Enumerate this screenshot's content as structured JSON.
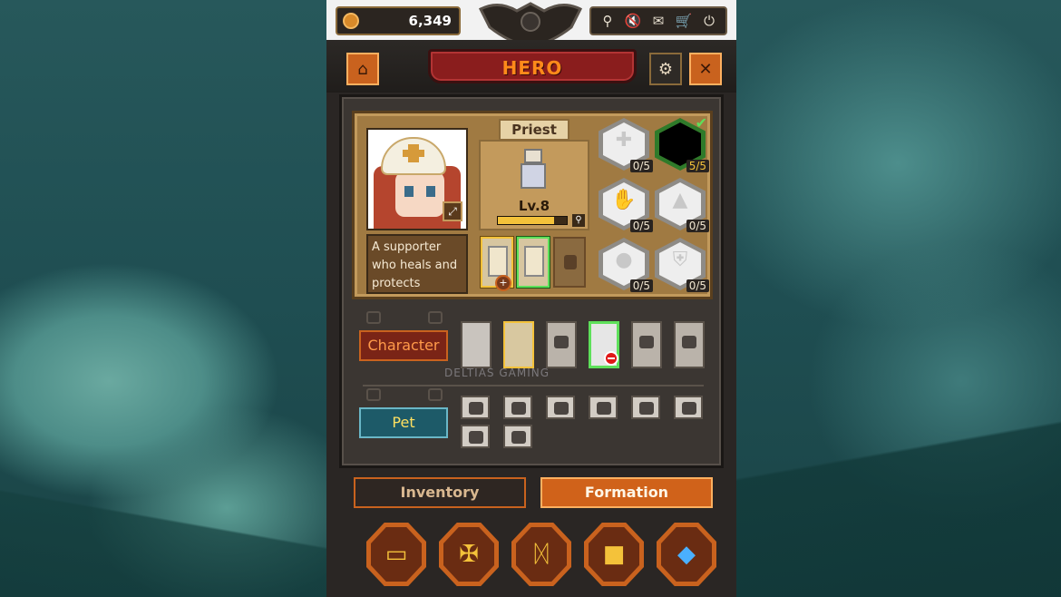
{
  "currency": {
    "value": "6,349",
    "icon": "coin-icon"
  },
  "system_icons": [
    "pin-icon",
    "sound-muted-icon",
    "mail-icon",
    "shop-cart-icon",
    "power-icon"
  ],
  "header": {
    "title": "HERO",
    "back_icon": "exit-door-icon",
    "settings_icon": "gear-icon",
    "close_icon": "close-icon"
  },
  "hero": {
    "class_name": "Priest",
    "level_label": "Lv.8",
    "xp_fraction": 0.82,
    "description": "A supporter who heals and protects",
    "skin_slots": [
      {
        "state": "owned"
      },
      {
        "state": "selected"
      },
      {
        "state": "locked"
      }
    ],
    "equipment": [
      {
        "icon": "cross-shield-icon",
        "count": "0/5",
        "equipped": false
      },
      {
        "icon": "dark-gem-icon",
        "count": "5/5",
        "equipped": true
      },
      {
        "icon": "hand-icon",
        "count": "0/5",
        "equipped": false
      },
      {
        "icon": "flame-icon",
        "count": "0/5",
        "equipped": false
      },
      {
        "icon": "bomb-icon",
        "count": "0/5",
        "equipped": false
      },
      {
        "icon": "armor-icon",
        "count": "0/5",
        "equipped": false
      }
    ]
  },
  "roster": {
    "character_label": "Character",
    "pet_label": "Pet",
    "characters": [
      {
        "name": "knight",
        "state": "owned"
      },
      {
        "name": "hero-blonde",
        "state": "selected"
      },
      {
        "name": "locked-1",
        "state": "locked"
      },
      {
        "name": "priest",
        "state": "in-formation"
      },
      {
        "name": "locked-2",
        "state": "locked"
      },
      {
        "name": "locked-3",
        "state": "locked"
      }
    ],
    "pet_slot_count": 8,
    "watermark": "DELTIAS GAMING"
  },
  "tabs": [
    {
      "label": "Inventory",
      "active": false
    },
    {
      "label": "Formation",
      "active": true
    }
  ],
  "bottom_nav": [
    {
      "icon": "chest-icon"
    },
    {
      "icon": "cross-icon"
    },
    {
      "icon": "rune-icon"
    },
    {
      "icon": "box-icon"
    },
    {
      "icon": "crystal-icon"
    }
  ]
}
